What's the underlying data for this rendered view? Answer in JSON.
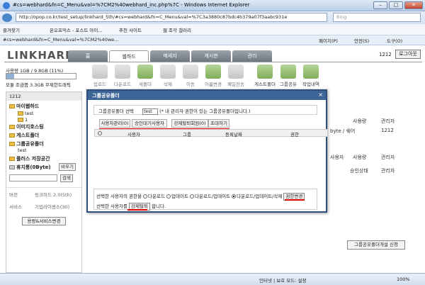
{
  "window": {
    "title": "#cs=webhard&fn=C_Menu&val=%7CM2%40webhard_inc.php%7C - Windows Internet Explorer",
    "address": "http://opop.co.kr/test_setup/linkhard_5th/#cs=webhard&fn=C_Menu&val=%7C3a3880c87bdc4b379a07f3aabc931e",
    "search_placeholder": "Bing",
    "tab_label": "#cs=webhard&fn=C_Menu&val=%7CM2%40we...",
    "favorites": [
      "즐겨찾기",
      "온오프믹스 - 포스트 아이...",
      "추천 사이트",
      "웹 조각 갤러리"
    ],
    "right_menu": [
      "페이지(P)",
      "안전(S)",
      "도구(O)"
    ]
  },
  "app": {
    "logo": "LINKHARD",
    "nav": [
      "홈",
      "웹하드",
      "메세지",
      "게시판",
      "관리"
    ],
    "active_nav_index": 1,
    "page_num": "1212",
    "logout": "로그아웃"
  },
  "left": {
    "usage_text": "사용량 1GB / 9.8GB (11%)",
    "usage_percent": 11,
    "quota_text": "모듈 조금쯤 3.3GB 무제한트래픽",
    "panel_header": "1212",
    "tree": [
      "마이웹하드",
      "test",
      "1",
      "이미지호스팅",
      "게스트폴더",
      "그룹공유폴더",
      "test",
      "플러스 저장공간",
      "휴지통(0Byte)"
    ],
    "empty_btn": "비우기",
    "search_btn": "검색",
    "info_rows": [
      [
        "버전",
        "링크하드 2.0(5th)"
      ],
      [
        "서비스",
        "기업라이센스(30)"
      ]
    ],
    "upgrade_btn": "용량&서비스변경"
  },
  "toolbar": [
    "업로드",
    "다운로드",
    "새폴더",
    "삭제",
    "이동",
    "이름변경",
    "폐일전송",
    "게스트폴더",
    "그룹공유",
    "작업내역"
  ],
  "background": {
    "headers": [
      "사용량",
      "관리자"
    ],
    "row": [
      "byte / 쉐어",
      "1212"
    ],
    "headers2": [
      "사용자",
      "사용량",
      "관리자"
    ],
    "status_label": "승인상태",
    "create_btn": "그룹공유폴더개설 신청"
  },
  "modal": {
    "title": "그룹공유폴더",
    "close": "×",
    "select_label": "그룹공유폴더 선택",
    "select_value": "test",
    "select_note": "(* 내 관리자 권한이 있는 그룹공유폴더입니다.)",
    "tabs": [
      "사용자관리(0)",
      "승인대기사용자(0)",
      "강제탈퇴회원(0)",
      "초대하기"
    ],
    "columns": [
      "사용자",
      "그룹",
      "등록날짜",
      "권한"
    ],
    "perm_label": "선택한 사용자의 권한을",
    "perm_options": [
      "다운로드",
      "업데이트",
      "다운로드/업데이트",
      "다운로드/업데이트/삭제"
    ],
    "perm_selected": 3,
    "perm_btn": "권한변경",
    "kick_prefix": "선택한 사용자를",
    "kick_btn": "강제탈퇴",
    "kick_suffix": "합니다."
  },
  "status": {
    "security": "인터넷 | 보호 모드: 설정",
    "zoom": "100%"
  }
}
